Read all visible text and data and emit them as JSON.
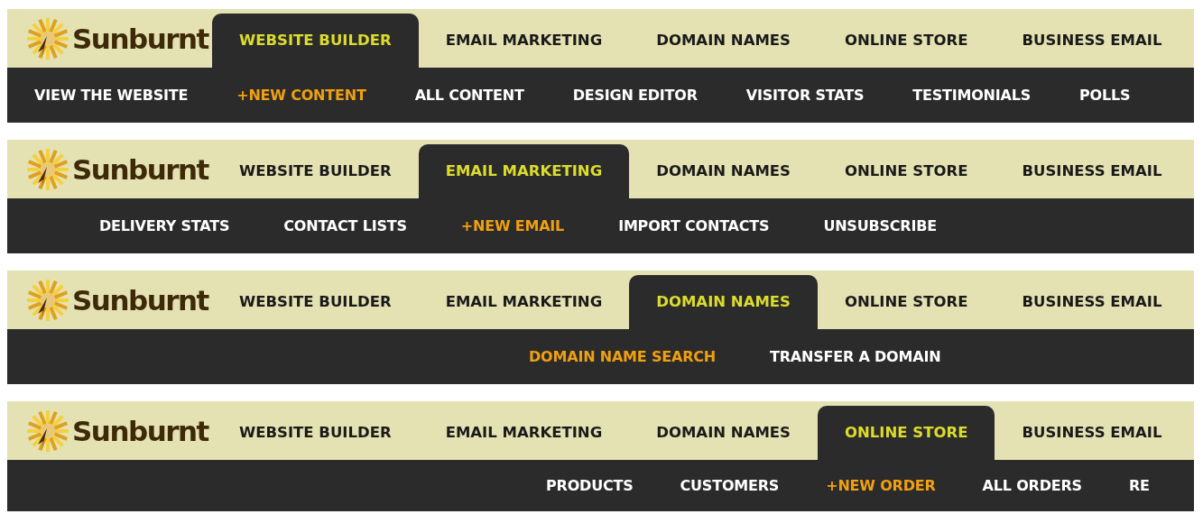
{
  "bars": [
    {
      "logo": "Sunburnt",
      "tabs": [
        {
          "label": "WEBSITE BUILDER",
          "selected": true
        },
        {
          "label": "EMAIL MARKETING",
          "selected": false
        },
        {
          "label": "DOMAIN NAMES",
          "selected": false
        },
        {
          "label": "ONLINE STORE",
          "selected": false
        },
        {
          "label": "BUSINESS EMAIL",
          "selected": false
        }
      ],
      "subnav": [
        {
          "label": "VIEW THE WEBSITE",
          "selected": false
        },
        {
          "label": "+NEW CONTENT",
          "selected": true
        },
        {
          "label": "ALL CONTENT",
          "selected": false
        },
        {
          "label": "DESIGN EDITOR",
          "selected": false
        },
        {
          "label": "VISITOR STATS",
          "selected": false
        },
        {
          "label": "TESTIMONIALS",
          "selected": false
        },
        {
          "label": "POLLS",
          "selected": false
        }
      ]
    },
    {
      "logo": "Sunburnt",
      "tabs": [
        {
          "label": "WEBSITE BUILDER",
          "selected": false
        },
        {
          "label": "EMAIL MARKETING",
          "selected": true
        },
        {
          "label": "DOMAIN NAMES",
          "selected": false
        },
        {
          "label": "ONLINE STORE",
          "selected": false
        },
        {
          "label": "BUSINESS EMAIL",
          "selected": false
        }
      ],
      "subnav": [
        {
          "label": "DELIVERY STATS",
          "selected": false
        },
        {
          "label": "CONTACT LISTS",
          "selected": false
        },
        {
          "label": "+NEW EMAIL",
          "selected": true
        },
        {
          "label": "IMPORT CONTACTS",
          "selected": false
        },
        {
          "label": "UNSUBSCRIBE",
          "selected": false
        }
      ]
    },
    {
      "logo": "Sunburnt",
      "tabs": [
        {
          "label": "WEBSITE BUILDER",
          "selected": false
        },
        {
          "label": "EMAIL MARKETING",
          "selected": false
        },
        {
          "label": "DOMAIN NAMES",
          "selected": true
        },
        {
          "label": "ONLINE STORE",
          "selected": false
        },
        {
          "label": "BUSINESS EMAIL",
          "selected": false
        }
      ],
      "subnav": [
        {
          "label": "DOMAIN NAME SEARCH",
          "selected": true
        },
        {
          "label": "TRANSFER A DOMAIN",
          "selected": false
        }
      ]
    },
    {
      "logo": "Sunburnt",
      "tabs": [
        {
          "label": "WEBSITE BUILDER",
          "selected": false
        },
        {
          "label": "EMAIL MARKETING",
          "selected": false
        },
        {
          "label": "DOMAIN NAMES",
          "selected": false
        },
        {
          "label": "ONLINE STORE",
          "selected": true
        },
        {
          "label": "BUSINESS EMAIL",
          "selected": false
        }
      ],
      "subnav": [
        {
          "label": "PRODUCTS",
          "selected": false
        },
        {
          "label": "CUSTOMERS",
          "selected": false
        },
        {
          "label": "+NEW ORDER",
          "selected": true
        },
        {
          "label": "ALL ORDERS",
          "selected": false
        },
        {
          "label": "RE",
          "selected": false
        }
      ]
    }
  ]
}
